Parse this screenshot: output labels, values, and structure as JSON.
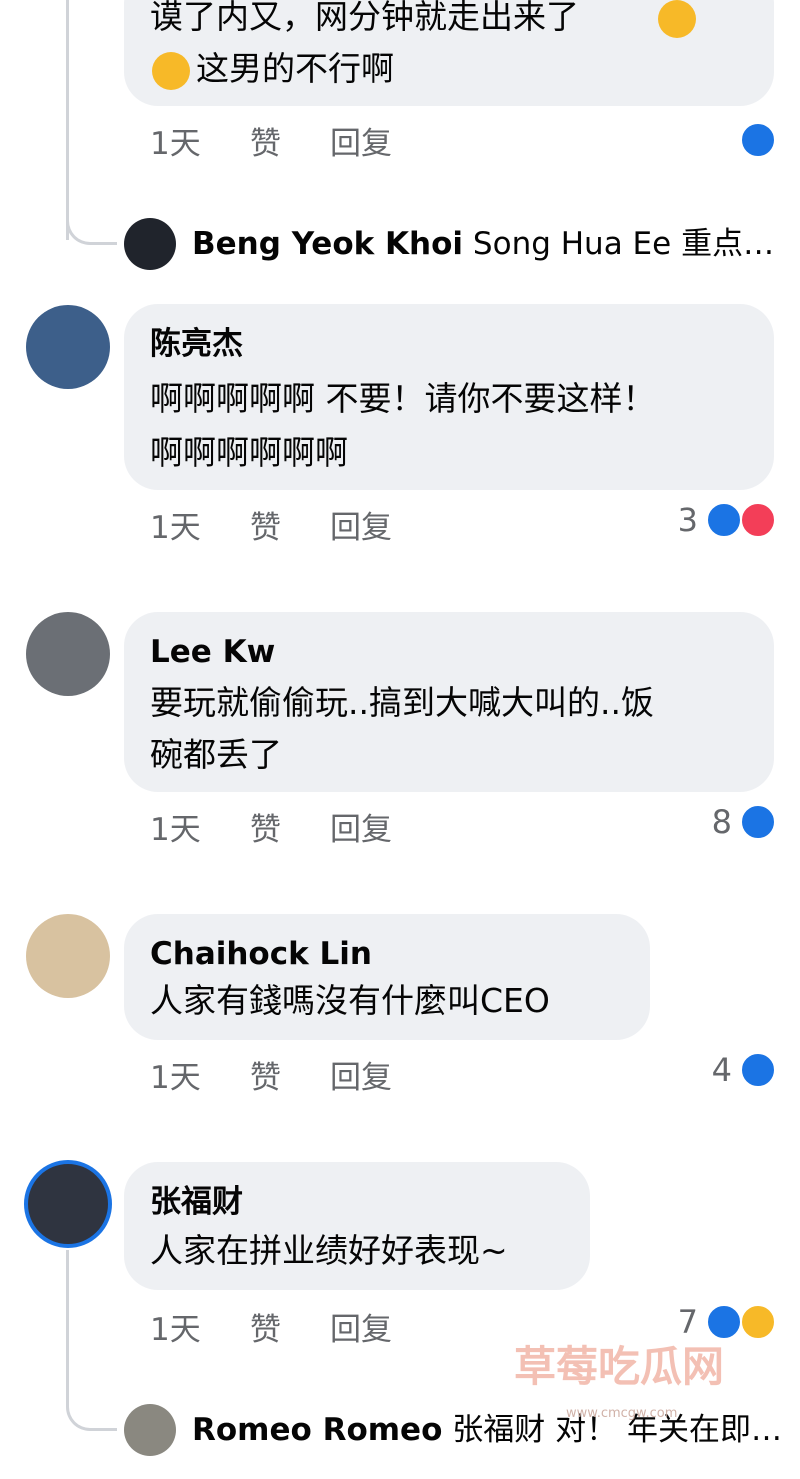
{
  "top_comment": {
    "line1": "谟了内又，网分钟就走出来了",
    "line2": "这男的不行啊",
    "meta": {
      "time": "1天",
      "like": "赞",
      "reply": "回复"
    }
  },
  "reply1": {
    "name": "Beng Yeok  Khoi",
    "preview": "Song Hua Ee 重点…"
  },
  "comments": [
    {
      "author": "陈亮杰",
      "lines": [
        "啊啊啊啊啊 不要！请你不要这样！",
        "啊啊啊啊啊啊"
      ],
      "meta": {
        "time": "1天",
        "like": "赞",
        "reply": "回复"
      },
      "reaction_count": "3",
      "reactions": [
        "like",
        "love"
      ]
    },
    {
      "author": "Lee Kw",
      "lines": [
        "要玩就偷偷玩..搞到大喊大叫的..饭",
        "碗都丢了"
      ],
      "meta": {
        "time": "1天",
        "like": "赞",
        "reply": "回复"
      },
      "reaction_count": "8",
      "reactions": [
        "like"
      ]
    },
    {
      "author": "Chaihock Lin",
      "lines": [
        "人家有錢嗎沒有什麼叫CEO"
      ],
      "meta": {
        "time": "1天",
        "like": "赞",
        "reply": "回复"
      },
      "reaction_count": "4",
      "reactions": [
        "like"
      ]
    },
    {
      "author": "张福财",
      "lines": [
        "人家在拼业绩好好表现~"
      ],
      "meta": {
        "time": "1天",
        "like": "赞",
        "reply": "回复"
      },
      "reaction_count": "7",
      "reactions": [
        "like",
        "haha"
      ]
    }
  ],
  "reply2": {
    "name": "Romeo Romeo",
    "preview": "张福财 对！ 年关在即…"
  },
  "watermark": {
    "main": "草莓吃瓜网",
    "url": "www.cmcgw.com"
  },
  "colors": {
    "like": "#1b74e4",
    "love": "#f33e58",
    "haha": "#f7b928",
    "bubble": "#eef0f3",
    "meta": "#65676b"
  }
}
